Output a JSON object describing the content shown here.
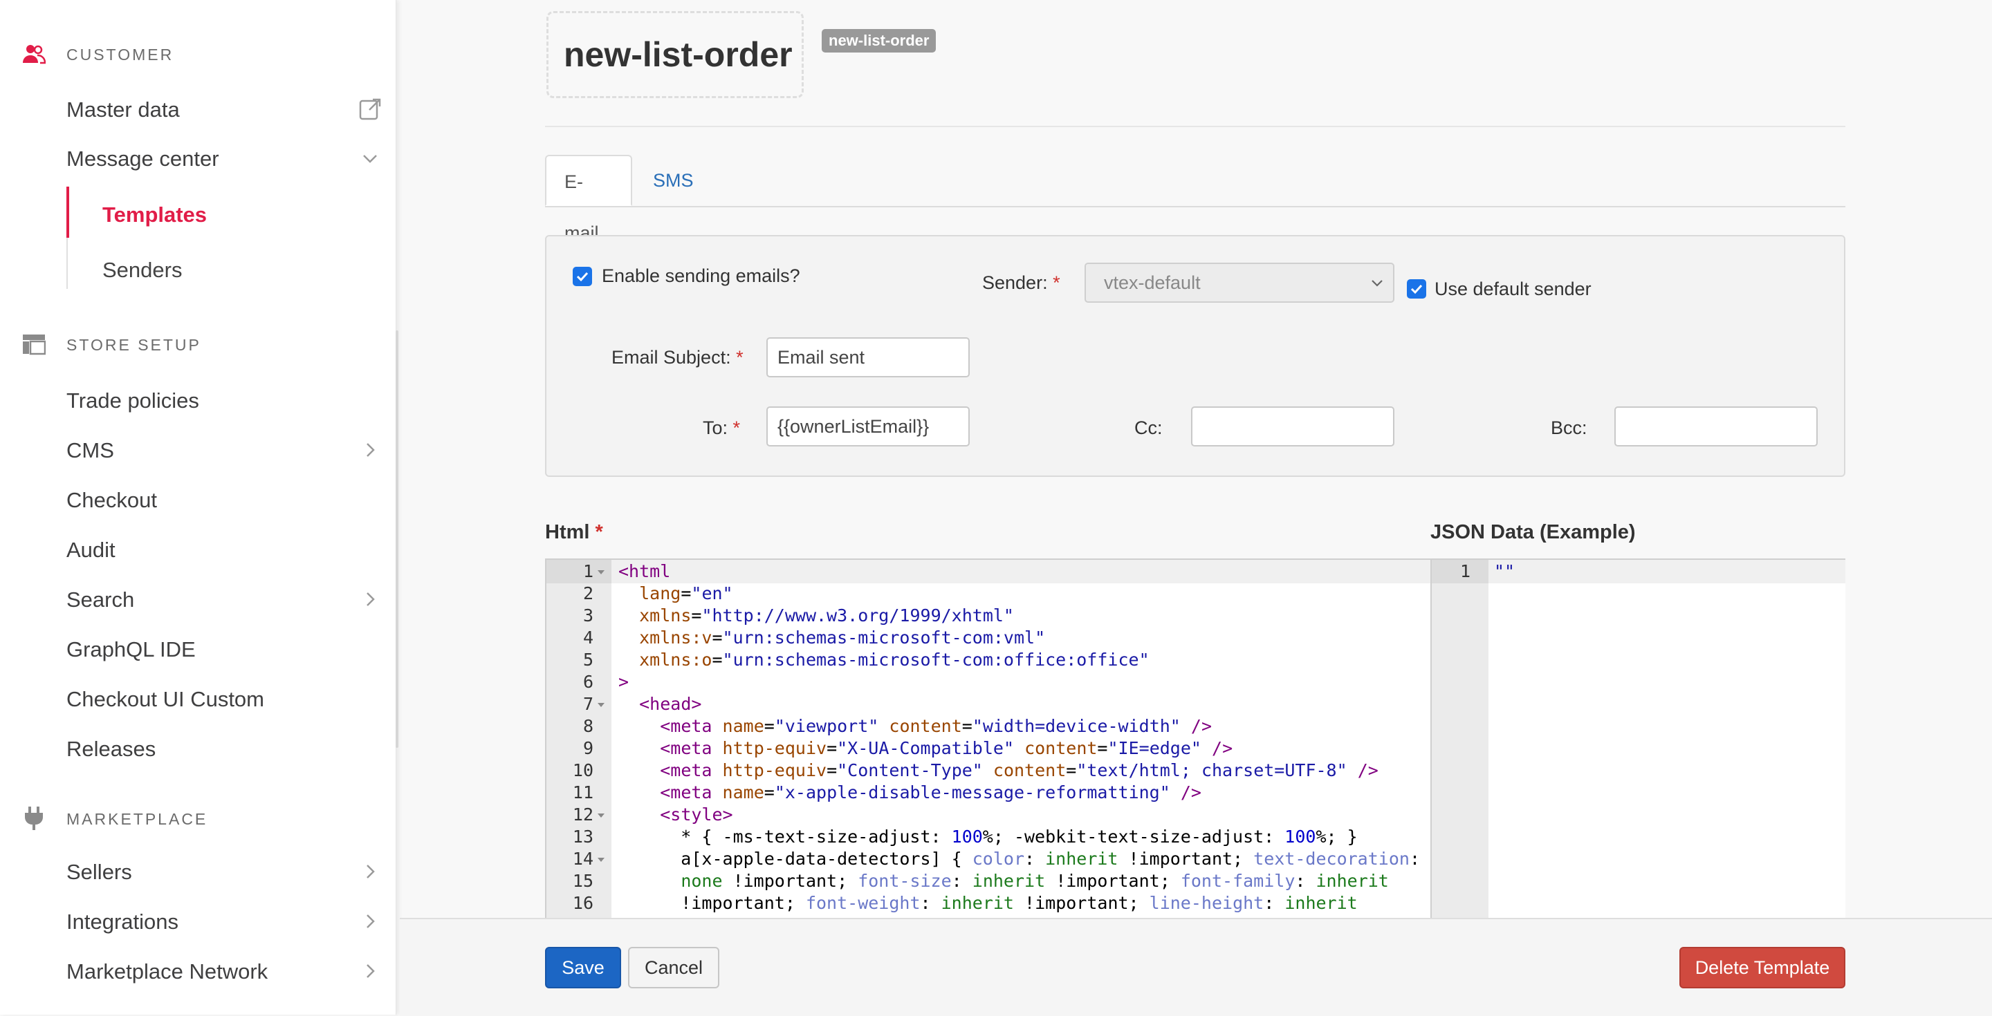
{
  "sidebar": {
    "customer": {
      "heading": "CUSTOMER",
      "items": [
        {
          "label": "Master data"
        },
        {
          "label": "Message center"
        }
      ],
      "subitems": [
        {
          "label": "Templates"
        },
        {
          "label": "Senders"
        }
      ]
    },
    "store_setup": {
      "heading": "STORE SETUP",
      "items": [
        {
          "label": "Trade policies"
        },
        {
          "label": "CMS"
        },
        {
          "label": "Checkout"
        },
        {
          "label": "Audit"
        },
        {
          "label": "Search"
        },
        {
          "label": "GraphQL IDE"
        },
        {
          "label": "Checkout UI Custom"
        },
        {
          "label": "Releases"
        }
      ]
    },
    "marketplace": {
      "heading": "MARKETPLACE",
      "items": [
        {
          "label": "Sellers"
        },
        {
          "label": "Integrations"
        },
        {
          "label": "Marketplace Network"
        }
      ]
    }
  },
  "page": {
    "title": "new-list-order",
    "badge": "new-list-order"
  },
  "tabs": [
    {
      "label": "E-mail",
      "active": true
    },
    {
      "label": "SMS",
      "active": false
    }
  ],
  "form": {
    "enable_label": "Enable sending emails?",
    "sender_label": "Sender:",
    "sender_value": "vtex-default",
    "use_default_label": "Use default sender",
    "subject_label": "Email Subject:",
    "subject_value": "Email sent",
    "to_label": "To:",
    "to_value": "{{ownerListEmail}}",
    "cc_label": "Cc:",
    "cc_value": "",
    "bcc_label": "Bcc:",
    "bcc_value": "",
    "required_mark": "*"
  },
  "html_editor": {
    "label": "Html",
    "required_mark": "*",
    "line_numbers": [
      "1",
      "2",
      "3",
      "4",
      "5",
      "6",
      "7",
      "8",
      "9",
      "10",
      "11",
      "12",
      "13",
      "14",
      "15",
      "16"
    ]
  },
  "json_editor": {
    "label": "JSON Data (Example)",
    "line_numbers": [
      "1"
    ],
    "content": "\"\""
  },
  "actions": {
    "save": "Save",
    "cancel": "Cancel",
    "delete": "Delete Template"
  },
  "colors": {
    "accent": "#e11d48",
    "primary": "#1c66c4",
    "danger": "#d04a3f",
    "link": "#2a6fb8"
  }
}
